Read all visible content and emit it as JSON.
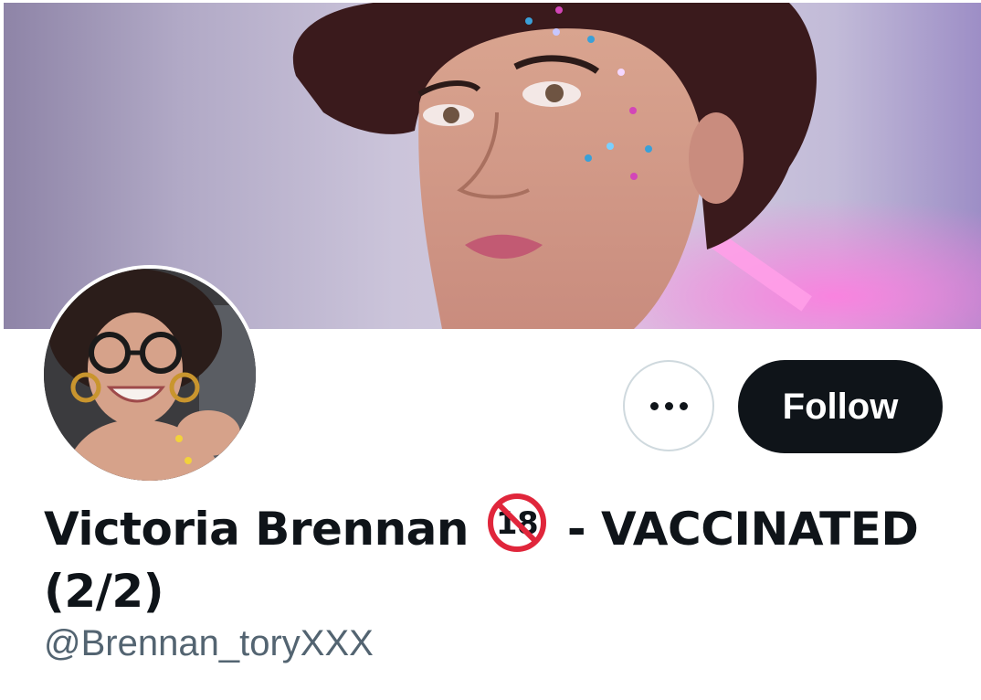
{
  "profile": {
    "name_main": "Victoria Brennan",
    "name_badge": "18",
    "name_rest": "- VACCINATED (2/2)",
    "handle": "@Brennan_toryXXX"
  },
  "actions": {
    "more_label": "More",
    "follow_label": "Follow"
  },
  "icons": {
    "more": "ellipsis-icon",
    "badge": "no-under-18-icon"
  },
  "colors": {
    "follow_bg": "#0f1419",
    "handle": "#536471",
    "badge_red": "#e0263b"
  }
}
